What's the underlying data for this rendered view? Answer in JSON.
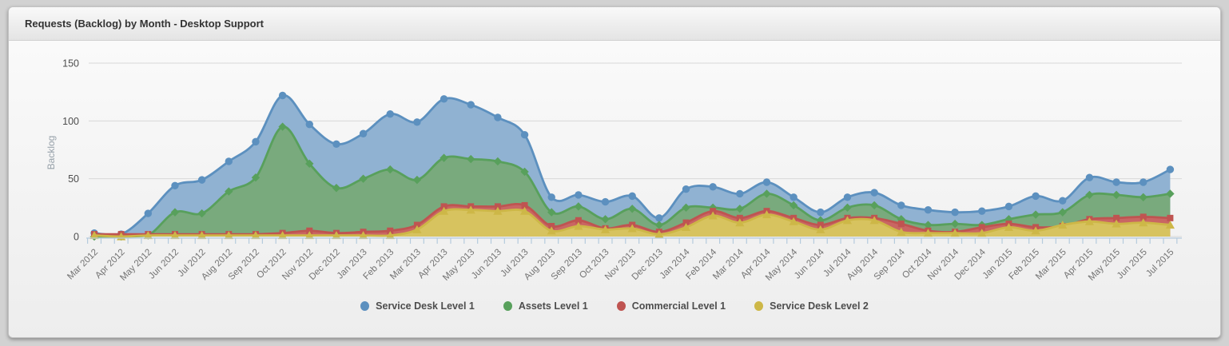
{
  "panel": {
    "title": "Requests (Backlog) by Month - Desktop Support"
  },
  "chart_data": {
    "type": "area",
    "title": "Requests (Backlog) by Month - Desktop Support",
    "xlabel": "",
    "ylabel": "Backlog",
    "ylim": [
      0,
      150
    ],
    "yticks": [
      0,
      50,
      100,
      150
    ],
    "grid": true,
    "legend_position": "bottom",
    "overlap_mode": "overlapping-areas (not stacked), drawn in series order",
    "categories": [
      "Mar 2012",
      "Apr 2012",
      "May 2012",
      "Jun 2012",
      "Jul 2012",
      "Aug 2012",
      "Sep 2012",
      "Oct 2012",
      "Nov 2012",
      "Dec 2012",
      "Jan 2013",
      "Feb 2013",
      "Mar 2013",
      "Apr 2013",
      "May 2013",
      "Jun 2013",
      "Jul 2013",
      "Aug 2013",
      "Sep 2013",
      "Oct 2013",
      "Nov 2013",
      "Dec 2013",
      "Jan 2014",
      "Feb 2014",
      "Mar 2014",
      "Apr 2014",
      "May 2014",
      "Jun 2014",
      "Jul 2014",
      "Aug 2014",
      "Sep 2014",
      "Oct 2014",
      "Nov 2014",
      "Dec 2014",
      "Jan 2015",
      "Feb 2015",
      "Mar 2015",
      "Apr 2015",
      "May 2015",
      "Jun 2015",
      "Jul 2015"
    ],
    "series": [
      {
        "name": "Service Desk Level 1",
        "marker": "circle",
        "color": "#5c90bf",
        "fill": "#90b2d2",
        "values": [
          3,
          2,
          20,
          44,
          49,
          65,
          82,
          122,
          97,
          80,
          89,
          106,
          99,
          119,
          114,
          103,
          88,
          34,
          36,
          30,
          35,
          16,
          41,
          43,
          37,
          47,
          34,
          21,
          34,
          38,
          27,
          23,
          21,
          22,
          26,
          35,
          31,
          51,
          47,
          47,
          58
        ]
      },
      {
        "name": "Assets Level 1",
        "marker": "diamond",
        "color": "#58a05c",
        "fill": "#79aa7d",
        "values": [
          0,
          0,
          1,
          21,
          20,
          39,
          51,
          95,
          63,
          42,
          50,
          58,
          49,
          68,
          67,
          65,
          56,
          21,
          26,
          15,
          24,
          10,
          25,
          25,
          24,
          37,
          27,
          14,
          25,
          27,
          15,
          10,
          11,
          10,
          15,
          19,
          21,
          36,
          36,
          34,
          37
        ]
      },
      {
        "name": "Commercial Level 1",
        "marker": "square",
        "color": "#bf5451",
        "fill": "#c96663",
        "values": [
          2,
          2,
          2,
          2,
          2,
          2,
          2,
          3,
          5,
          3,
          4,
          5,
          10,
          26,
          26,
          26,
          27,
          9,
          14,
          7,
          10,
          4,
          12,
          22,
          16,
          22,
          16,
          10,
          16,
          16,
          11,
          5,
          4,
          8,
          11,
          8,
          9,
          15,
          16,
          17,
          16
        ]
      },
      {
        "name": "Service Desk Level 2",
        "marker": "triangle",
        "color": "#cdb747",
        "fill": "#d7c35f",
        "values": [
          1,
          0,
          1,
          1,
          1,
          1,
          1,
          1,
          1,
          1,
          1,
          1,
          6,
          22,
          23,
          22,
          22,
          5,
          9,
          6,
          7,
          2,
          8,
          18,
          12,
          19,
          13,
          6,
          14,
          14,
          4,
          3,
          3,
          3,
          8,
          5,
          10,
          13,
          11,
          12,
          10
        ]
      }
    ],
    "axis_colors": {
      "gridline": "#d8d8d8",
      "axis_line": "#b5cbdd",
      "x_label": "#737373",
      "y_label": "#4d4d4d",
      "y_title": "#96a0a9"
    }
  }
}
